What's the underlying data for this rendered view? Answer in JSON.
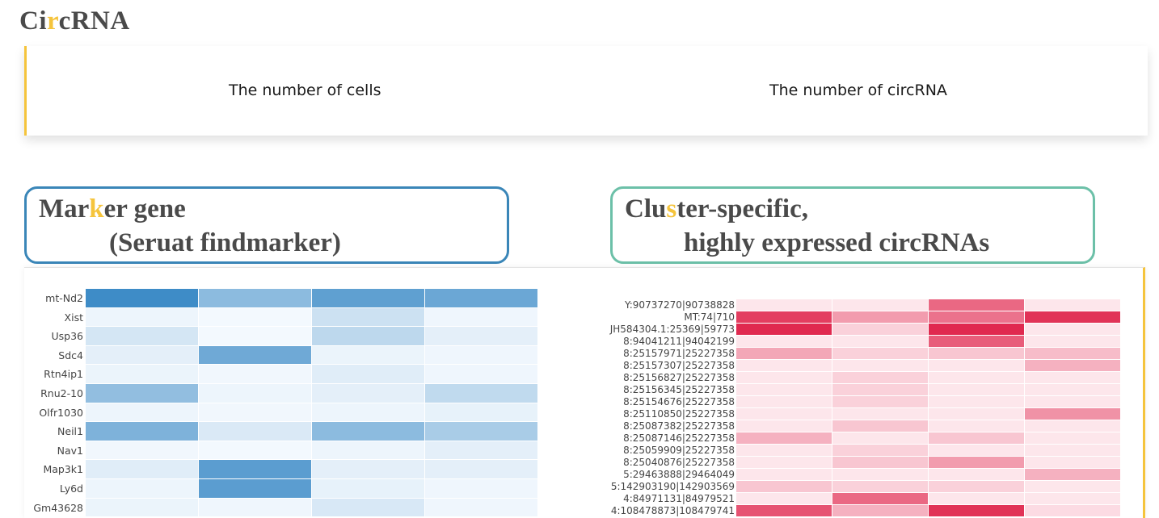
{
  "header": {
    "title_pre": "Ci",
    "title_hl": "r",
    "title_post": "cRNA"
  },
  "stats": {
    "cells_label": "The number of cells",
    "circrna_label": "The number of circRNA"
  },
  "marker_box": {
    "line1_pre": "Mar",
    "line1_hl": "k",
    "line1_post": "er gene",
    "line2": "(Seruat findmarker)",
    "border_color": "#3a86b8"
  },
  "cluster_box": {
    "line1_pre": "Clu",
    "line1_hl": "s",
    "line1_post": "ter-specific,",
    "line2": "highly expressed circRNAs",
    "border_color": "#6cc0a8"
  },
  "accent_color": "#f5c43c",
  "marker_heatmap": {
    "palette": "blue",
    "rows": [
      "mt-Nd2",
      "Xist",
      "Usp36",
      "Sdc4",
      "Rtn4ip1",
      "Rnu2-10",
      "Olfr1030",
      "Neil1",
      "Nav1",
      "Map3k1",
      "Ly6d",
      "Gm43628"
    ],
    "values": [
      [
        0.95,
        0.55,
        0.78,
        0.72
      ],
      [
        0.05,
        0.02,
        0.22,
        0.04
      ],
      [
        0.18,
        0.02,
        0.3,
        0.1
      ],
      [
        0.1,
        0.7,
        0.06,
        0.04
      ],
      [
        0.06,
        0.03,
        0.12,
        0.04
      ],
      [
        0.52,
        0.05,
        0.1,
        0.28
      ],
      [
        0.05,
        0.03,
        0.05,
        0.08
      ],
      [
        0.62,
        0.15,
        0.55,
        0.4
      ],
      [
        0.03,
        0.02,
        0.05,
        0.1
      ],
      [
        0.12,
        0.8,
        0.1,
        0.1
      ],
      [
        0.05,
        0.8,
        0.08,
        0.04
      ],
      [
        0.06,
        0.04,
        0.16,
        0.04
      ]
    ]
  },
  "circ_heatmap": {
    "palette": "red",
    "rows": [
      "Y:90737270|90738828",
      "MT:74|710",
      "JH584304.1:25369|59773",
      "8:94041211|94042199",
      "8:25157971|25227358",
      "8:25157307|25227358",
      "8:25156827|25227358",
      "8:25156345|25227358",
      "8:25154676|25227358",
      "8:25110850|25227358",
      "8:25087382|25227358",
      "8:25087146|25227358",
      "8:25059909|25227358",
      "8:25040876|25227358",
      "5:29463888|29464049",
      "5:142903190|142903569",
      "4:84971131|84979521",
      "4:108478873|108479741"
    ],
    "values": [
      [
        0.05,
        0.05,
        0.65,
        0.05
      ],
      [
        0.85,
        0.4,
        0.6,
        0.9
      ],
      [
        0.95,
        0.15,
        0.95,
        0.05
      ],
      [
        0.05,
        0.05,
        0.7,
        0.05
      ],
      [
        0.35,
        0.15,
        0.2,
        0.25
      ],
      [
        0.05,
        0.05,
        0.05,
        0.3
      ],
      [
        0.05,
        0.15,
        0.05,
        0.05
      ],
      [
        0.05,
        0.15,
        0.05,
        0.05
      ],
      [
        0.05,
        0.15,
        0.05,
        0.05
      ],
      [
        0.05,
        0.05,
        0.05,
        0.45
      ],
      [
        0.05,
        0.2,
        0.05,
        0.05
      ],
      [
        0.3,
        0.05,
        0.2,
        0.05
      ],
      [
        0.05,
        0.15,
        0.05,
        0.05
      ],
      [
        0.05,
        0.2,
        0.4,
        0.05
      ],
      [
        0.05,
        0.05,
        0.05,
        0.3
      ],
      [
        0.2,
        0.15,
        0.15,
        0.05
      ],
      [
        0.05,
        0.65,
        0.05,
        0.05
      ],
      [
        0.75,
        0.3,
        0.9,
        0.1
      ]
    ]
  }
}
